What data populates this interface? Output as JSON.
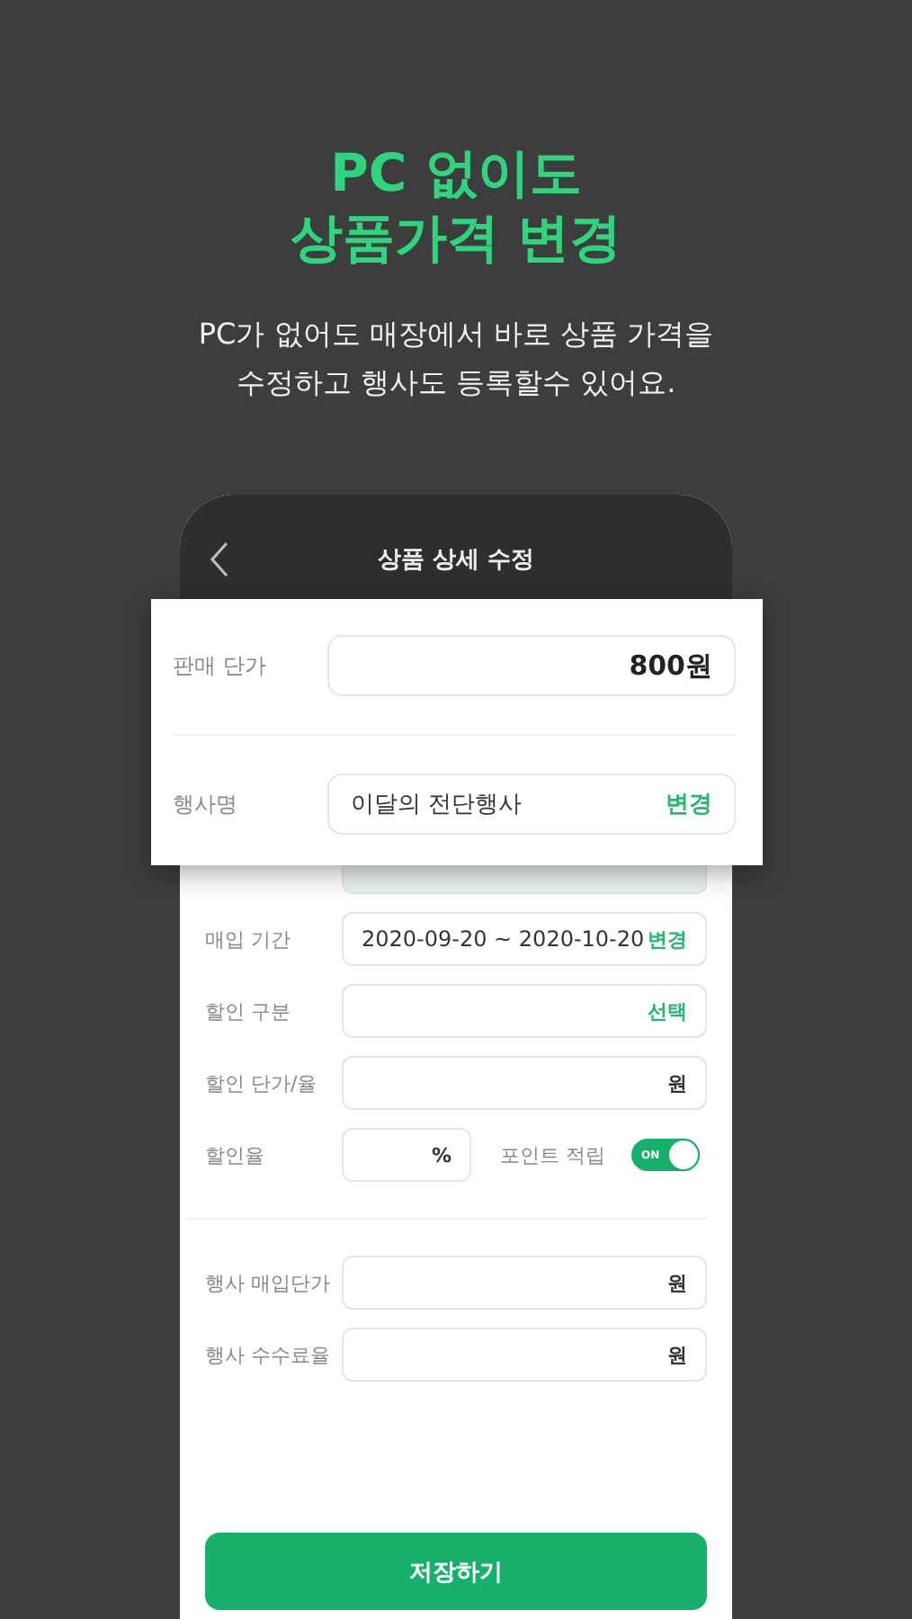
{
  "headline": [
    "PC 없이도",
    "상품가격 변경"
  ],
  "subtitle": [
    "PC가 없어도 매장에서 바로 상품 가격을",
    "수정하고 행사도 등록할수 있어요."
  ],
  "phone": {
    "title": "상품 상세 수정",
    "rows": [
      {
        "kind": "action",
        "label": "매입 기간",
        "value": "2020-09-20 ~ 2020-10-20",
        "action": "변경"
      },
      {
        "kind": "action",
        "label": "할인 구분",
        "action": "선택"
      },
      {
        "kind": "unit",
        "label": "할인 단가/율",
        "unit": "원"
      },
      {
        "kind": "split",
        "label": "할인율",
        "unit": "%",
        "toggle": {
          "label": "포인트 적립",
          "text": "ON",
          "on": true
        }
      }
    ],
    "event_rows": [
      {
        "kind": "unit",
        "label": "행사 매입단가",
        "unit": "원"
      },
      {
        "kind": "unit",
        "label": "행사 수수료율",
        "unit": "원"
      }
    ],
    "save_button": "저장하기"
  },
  "popup": {
    "rows": [
      {
        "kind": "amount",
        "label": "판매 단가",
        "value": "800원"
      },
      {
        "kind": "action",
        "label": "행사명",
        "value": "이달의 전단행사",
        "action": "변경"
      }
    ]
  }
}
